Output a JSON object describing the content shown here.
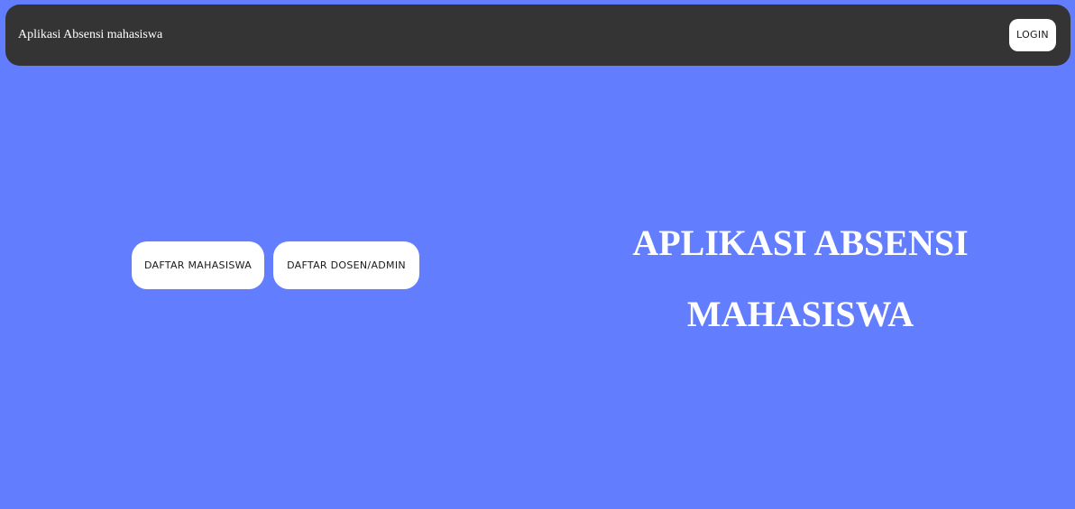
{
  "header": {
    "brand": "Aplikasi Absensi mahasiswa",
    "login_label": "LOGIN"
  },
  "actions": {
    "daftar_mahasiswa_label": "DAFTAR MAHASISWA",
    "daftar_dosen_label": "DAFTAR DOSEN/ADMIN"
  },
  "hero": {
    "title_line1": "APLIKASI ABSENSI",
    "title_line2": "MAHASISWA"
  },
  "colors": {
    "background": "#637dff",
    "navbar": "#343434",
    "button": "#ffffff"
  }
}
